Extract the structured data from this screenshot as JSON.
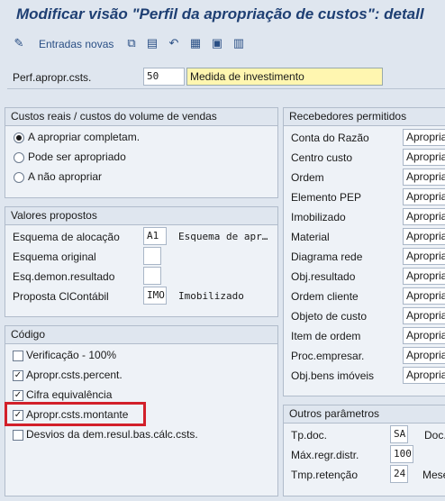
{
  "title": "Modificar visão \"Perfil da apropriação de custos\": detall",
  "toolbar": {
    "new_entries_label": "Entradas novas"
  },
  "header": {
    "label": "Perf.apropr.csts.",
    "code": "50",
    "description": "Medida de investimento"
  },
  "actual_costs": {
    "title": "Custos reais / custos do volume de vendas",
    "options": [
      {
        "label": "A apropriar completam.",
        "selected": true
      },
      {
        "label": "Pode ser apropriado",
        "selected": false
      },
      {
        "label": "A não apropriar",
        "selected": false
      }
    ]
  },
  "default_values": {
    "title": "Valores propostos",
    "rows": [
      {
        "label": "Esquema de alocação",
        "value": "A1",
        "text": "Esquema de apr…"
      },
      {
        "label": "Esquema original",
        "value": "",
        "text": ""
      },
      {
        "label": "Esq.demon.resultado",
        "value": "",
        "text": ""
      },
      {
        "label": "Proposta ClContábil",
        "value": "IMO",
        "text": "Imobilizado"
      }
    ]
  },
  "code_group": {
    "title": "Código",
    "checks": [
      {
        "label": "Verificação - 100%",
        "checked": false
      },
      {
        "label": "Apropr.csts.percent.",
        "checked": true
      },
      {
        "label": "Cifra equivalência",
        "checked": true
      },
      {
        "label": "Apropr.csts.montante",
        "checked": true
      },
      {
        "label": "Desvios da dem.resul.bas.cálc.csts.",
        "checked": false
      }
    ]
  },
  "receivers": {
    "title": "Recebedores permitidos",
    "rows": [
      {
        "label": "Conta do Razão",
        "value": "Apropria"
      },
      {
        "label": "Centro custo",
        "value": "Apropria"
      },
      {
        "label": "Ordem",
        "value": "Apropria"
      },
      {
        "label": "Elemento PEP",
        "value": "Apropria"
      },
      {
        "label": "Imobilizado",
        "value": "Apropria"
      },
      {
        "label": "Material",
        "value": "Apropria"
      },
      {
        "label": "Diagrama rede",
        "value": "Apropria"
      },
      {
        "label": "Obj.resultado",
        "value": "Apropria"
      },
      {
        "label": "Ordem cliente",
        "value": "Apropria"
      },
      {
        "label": "Objeto de custo",
        "value": "Apropria"
      },
      {
        "label": "Item de ordem",
        "value": "Apropria"
      },
      {
        "label": "Proc.empresar.",
        "value": "Apropria"
      },
      {
        "label": "Obj.bens imóveis",
        "value": "Apropria"
      }
    ]
  },
  "other_params": {
    "title": "Outros parâmetros",
    "rows": [
      {
        "label": "Tp.doc.",
        "value": "SA",
        "text": "Doc."
      },
      {
        "label": "Máx.regr.distr.",
        "value": "100",
        "text": ""
      },
      {
        "label": "Tmp.retenção",
        "value": "24",
        "text": "Mese"
      }
    ]
  }
}
